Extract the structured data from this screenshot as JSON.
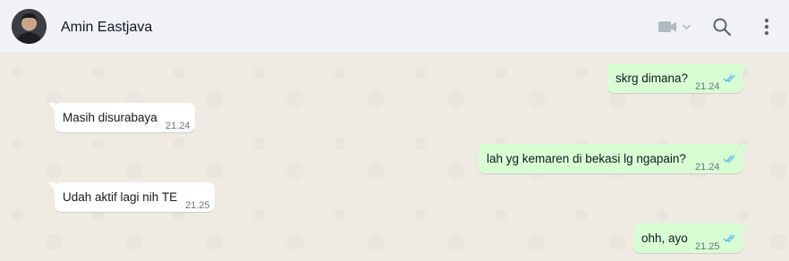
{
  "header": {
    "contact_name": "Amin Eastjava",
    "icons": {
      "avatar": "contact-avatar",
      "video": "video-call-icon",
      "search": "search-icon",
      "menu": "menu-dots-icon"
    }
  },
  "messages": [
    {
      "direction": "out",
      "text": "skrg dimana?",
      "time": "21.24",
      "status": "read"
    },
    {
      "direction": "in",
      "text": "Masih disurabaya",
      "time": "21.24"
    },
    {
      "direction": "out",
      "text": "lah yg kemaren di bekasi lg ngapain?",
      "time": "21.24",
      "status": "read"
    },
    {
      "direction": "in",
      "text": "Udah aktif lagi nih TE",
      "time": "21.25"
    },
    {
      "direction": "out",
      "text": "ohh, ayo",
      "time": "21.25",
      "status": "read"
    }
  ],
  "colors": {
    "outgoing_bubble": "#d9fdd3",
    "incoming_bubble": "#ffffff",
    "read_ticks": "#53bdeb",
    "chat_background": "#efeae2",
    "header_background": "#f0f2f5"
  }
}
